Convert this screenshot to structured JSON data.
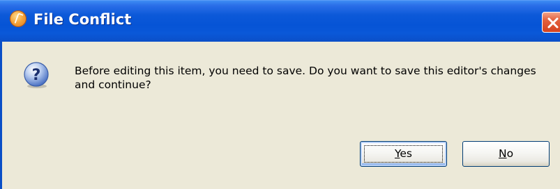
{
  "dialog": {
    "title": "File Conflict",
    "message": "Before editing this item, you need to save.  Do you want to save this editor's changes and continue?",
    "icons": {
      "title": "app-logo-icon",
      "message": "question-icon",
      "close": "close-icon"
    },
    "buttons": {
      "yes": {
        "mnemonic": "Y",
        "rest": "es"
      },
      "no": {
        "mnemonic": "N",
        "rest": "o"
      }
    }
  },
  "colors": {
    "titlebar": "#0654d6",
    "client_bg": "#ece9d8",
    "close_button": "#d5421f",
    "button_border": "#003c74"
  }
}
